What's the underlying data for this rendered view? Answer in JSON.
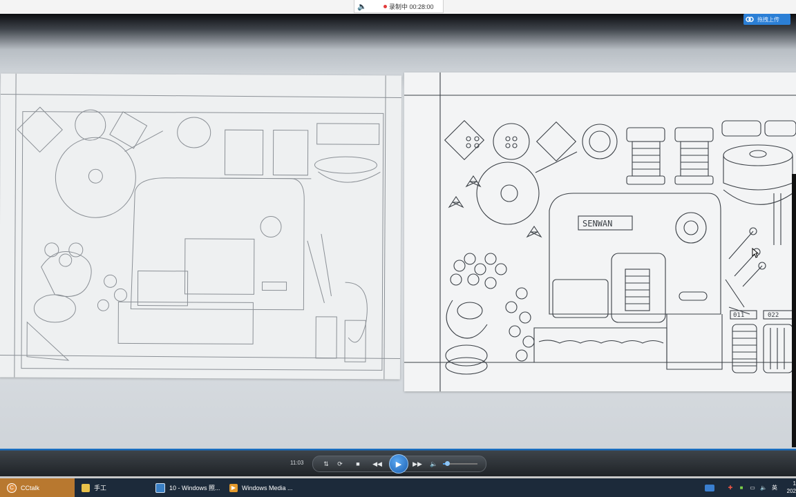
{
  "recorder": {
    "speaker_icon": "speaker-icon",
    "status": "录制中 00:28:00"
  },
  "upload_button": {
    "icon": "baidu-netdisk-icon",
    "label": "拖拽上传"
  },
  "video": {
    "machine_label": "SENWAN",
    "spool_labels": [
      "011",
      "022"
    ]
  },
  "player": {
    "time": "11:03",
    "buttons": [
      "shuffle",
      "repeat",
      "stop",
      "previous",
      "play",
      "next",
      "mute"
    ],
    "volume_level": 0.12,
    "accent": "#1a6ec1"
  },
  "taskbar": {
    "items": [
      {
        "label": "CCtalk",
        "icon": "cctalk-icon",
        "active": true
      },
      {
        "label": "手工",
        "icon": "folder-icon",
        "active": false
      },
      {
        "label": "10 - Windows 照...",
        "icon": "photos-icon",
        "active": false
      },
      {
        "label": "Windows Media ...",
        "icon": "media-player-icon",
        "active": false
      }
    ],
    "tray": {
      "ime": "英",
      "clock_time": "1",
      "clock_date": "202"
    }
  }
}
